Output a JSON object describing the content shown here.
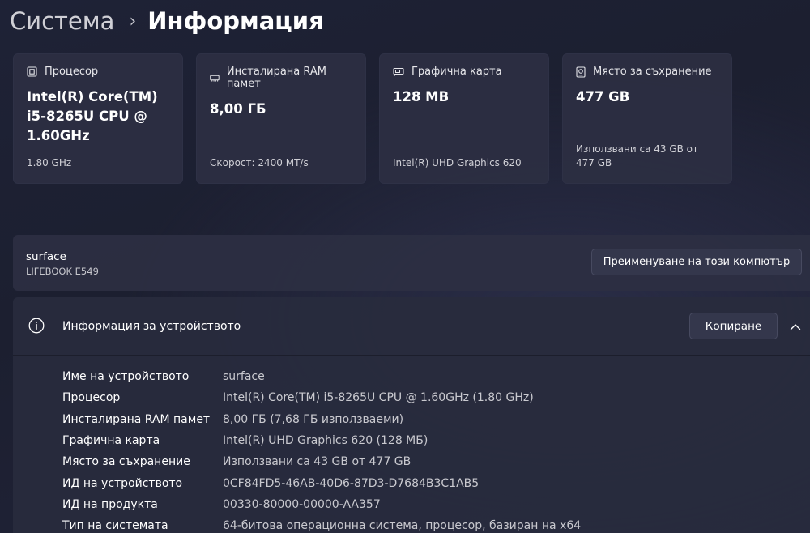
{
  "breadcrumb": {
    "parent": "Система",
    "current": "Информация"
  },
  "cards": [
    {
      "icon": "processor-icon",
      "label": "Процесор",
      "value": "Intel(R) Core(TM) i5-8265U CPU @ 1.60GHz",
      "sub": "1.80 GHz"
    },
    {
      "icon": "ram-icon",
      "label": "Инсталирана RAM памет",
      "value": "8,00 ГБ",
      "sub": "Скорост: 2400 MT/s"
    },
    {
      "icon": "graphics-card-icon",
      "label": "Графична карта",
      "value": "128 MB",
      "sub": "Intel(R) UHD Graphics 620"
    },
    {
      "icon": "storage-icon",
      "label": "Място за съхранение",
      "value": "477 GB",
      "sub": "Използвани са 43 GB от 477 GB"
    }
  ],
  "device_name": {
    "name": "surface",
    "model": "LIFEBOOK E549",
    "rename_label": "Преименуване на този компютър"
  },
  "device_specs": {
    "title": "Информация за устройството",
    "copy_label": "Копиране",
    "rows": [
      {
        "label": "Име на устройството",
        "value": "surface"
      },
      {
        "label": "Процесор",
        "value": "Intel(R) Core(TM) i5-8265U CPU @ 1.60GHz (1.80 GHz)"
      },
      {
        "label": "Инсталирана RAM памет",
        "value": "8,00 ГБ (7,68 ГБ използваеми)"
      },
      {
        "label": "Графична карта",
        "value": "Intel(R) UHD Graphics 620 (128 МБ)"
      },
      {
        "label": "Място за съхранение",
        "value": "Използвани са 43 GB от 477 GB"
      },
      {
        "label": "ИД на устройството",
        "value": "0CF84FD5-46AB-40D6-87D3-D7684B3C1AB5"
      },
      {
        "label": "ИД на продукта",
        "value": "00330-80000-00000-AA357"
      },
      {
        "label": "Тип на системата",
        "value": "64-битова операционна система, процесор, базиран на x64"
      }
    ]
  }
}
